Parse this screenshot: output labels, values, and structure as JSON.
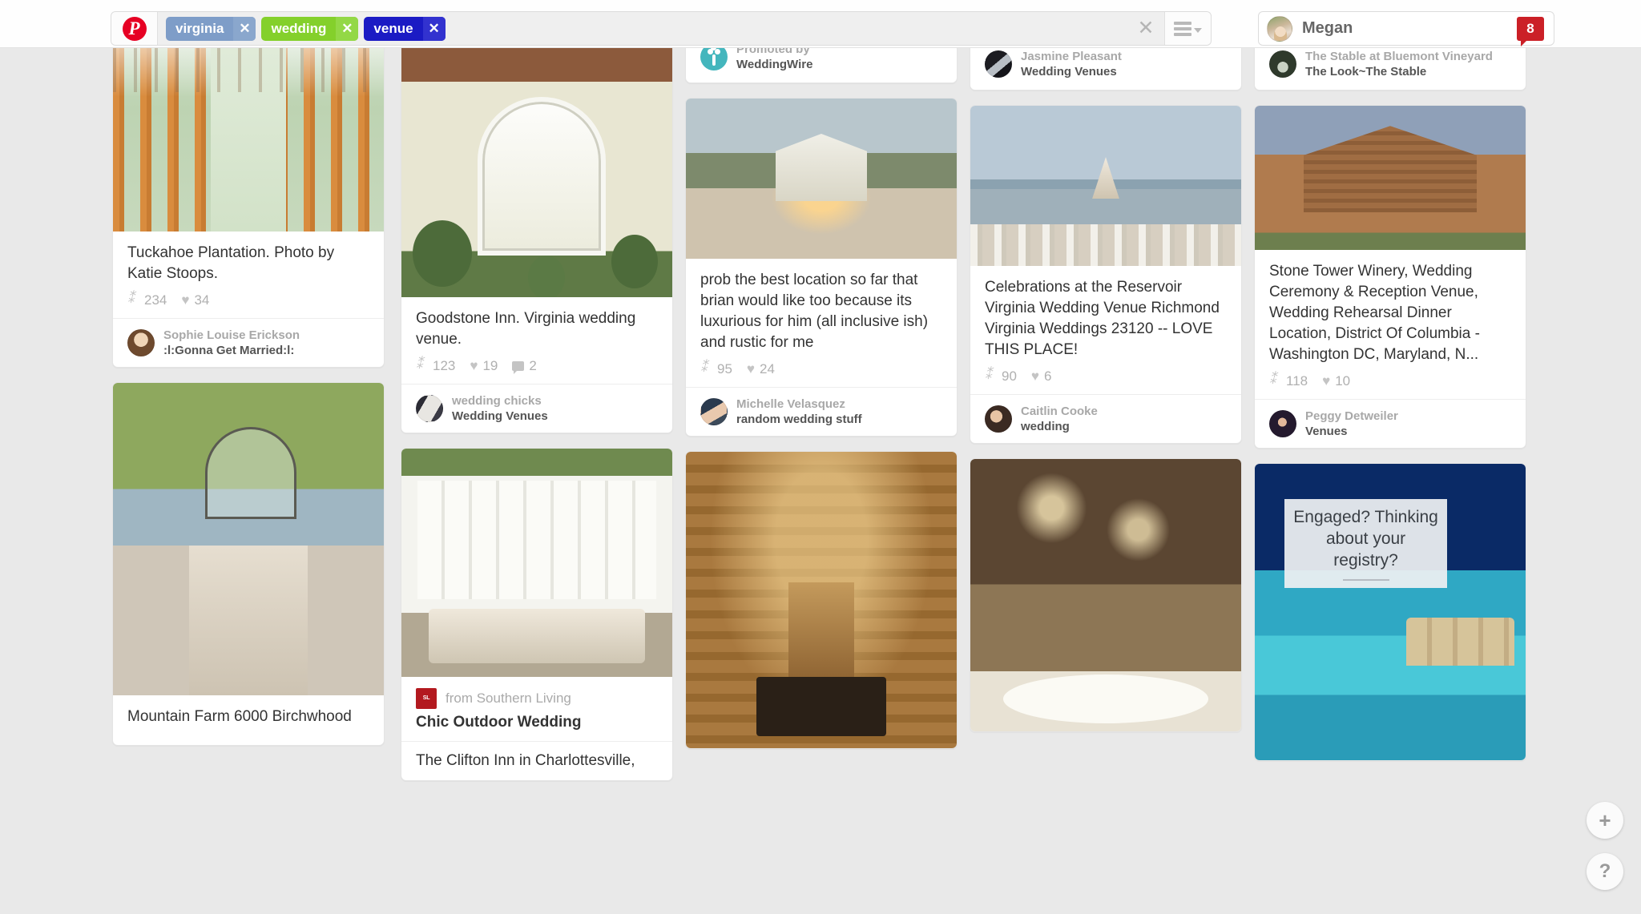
{
  "header": {
    "logo_icon": "pinterest-logo-icon",
    "search_tokens": [
      {
        "label": "virginia",
        "color": "#7e9dc8",
        "remove_icon": "close-icon"
      },
      {
        "label": "wedding",
        "color": "#84d02b",
        "remove_icon": "close-icon"
      },
      {
        "label": "venue",
        "color": "#1b1bc4",
        "remove_icon": "close-icon"
      }
    ],
    "clear_icon": "close-icon",
    "menu_icon": "hamburger-menu-icon",
    "user": {
      "name": "Megan",
      "avatar_icon": "user-avatar",
      "notification_count": "8"
    }
  },
  "floating": {
    "add_label": "+",
    "help_label": "?"
  },
  "columns": [
    {
      "id": "column-1",
      "cards": [
        {
          "type": "pin",
          "image": "wedding-aisle-chairs-photo",
          "title": "Tuckahoe Plantation. Photo by Katie Stoops.",
          "repins": "234",
          "likes": "34",
          "comments": null,
          "user": "Sophie Louise Erickson",
          "board": ":l:Gonna Get Married:l:"
        },
        {
          "type": "pin-partial",
          "image": "gazebo-lake-walkway-photo",
          "title": "Mountain Farm 6000 Birchwhood",
          "repins": null,
          "likes": null,
          "comments": null,
          "user": null,
          "board": null
        }
      ]
    },
    {
      "id": "column-2",
      "cards": [
        {
          "type": "pin",
          "image": "goodstone-inn-bride-photo",
          "title": "Goodstone Inn. Virginia wedding venue.",
          "repins": "123",
          "likes": "19",
          "comments": "2",
          "user": "wedding chicks",
          "board": "Wedding Venues"
        },
        {
          "type": "article",
          "image": "southern-porch-white-house-photo",
          "source": "from Southern Living",
          "source_logo": "southern-living-logo",
          "source_title": "Chic Outdoor Wedding",
          "title": "The Clifton Inn in Charlottesville,",
          "repins": null,
          "likes": null
        }
      ]
    },
    {
      "id": "column-3",
      "cards": [
        {
          "type": "promoted-stub",
          "promo_icon": "weddingwire-logo-icon",
          "promo_label": "Promoted by",
          "promo_name": "WeddingWire"
        },
        {
          "type": "pin",
          "image": "barn-venue-dusk-photo",
          "title": "prob the best location so far that brian would like too because its luxurious for him (all inclusive ish) and rustic for me",
          "repins": "95",
          "likes": "24",
          "comments": null,
          "user": "Michelle Velasquez",
          "board": "random wedding stuff"
        },
        {
          "type": "pin-partial",
          "image": "rustic-barn-interior-reception-photo"
        }
      ]
    },
    {
      "id": "column-4",
      "cards": [
        {
          "type": "stub",
          "avatar": "jasmine-avatar",
          "user": "Jasmine Pleasant",
          "board": "Wedding Venues"
        },
        {
          "type": "pin",
          "image": "lakeside-ceremony-chairs-photo",
          "title": "Celebrations at the Reservoir Virginia Wedding Venue Richmond Virginia Weddings 23120 -- LOVE THIS PLACE!",
          "repins": "90",
          "likes": "6",
          "comments": null,
          "user": "Caitlin Cooke",
          "board": "wedding"
        },
        {
          "type": "pin-partial",
          "image": "barn-string-lights-reception-photo"
        }
      ]
    },
    {
      "id": "column-5",
      "cards": [
        {
          "type": "stub",
          "avatar": "stable-avatar",
          "user": "The Stable at Bluemont Vineyard",
          "board": "The Look~The Stable"
        },
        {
          "type": "pin",
          "image": "stone-tower-winery-barn-photo",
          "title": "Stone Tower Winery, Wedding Ceremony & Reception Venue, Wedding Rehearsal Dinner Location, District Of Columbia - Washington DC, Maryland, N...",
          "repins": "118",
          "likes": "10",
          "comments": null,
          "user": "Peggy Detweiler",
          "board": "Venues"
        },
        {
          "type": "ad",
          "image": "tropical-overwater-bungalows-photo",
          "ad_line1": "Engaged? Thinking",
          "ad_line2": "about your registry?"
        }
      ]
    }
  ]
}
